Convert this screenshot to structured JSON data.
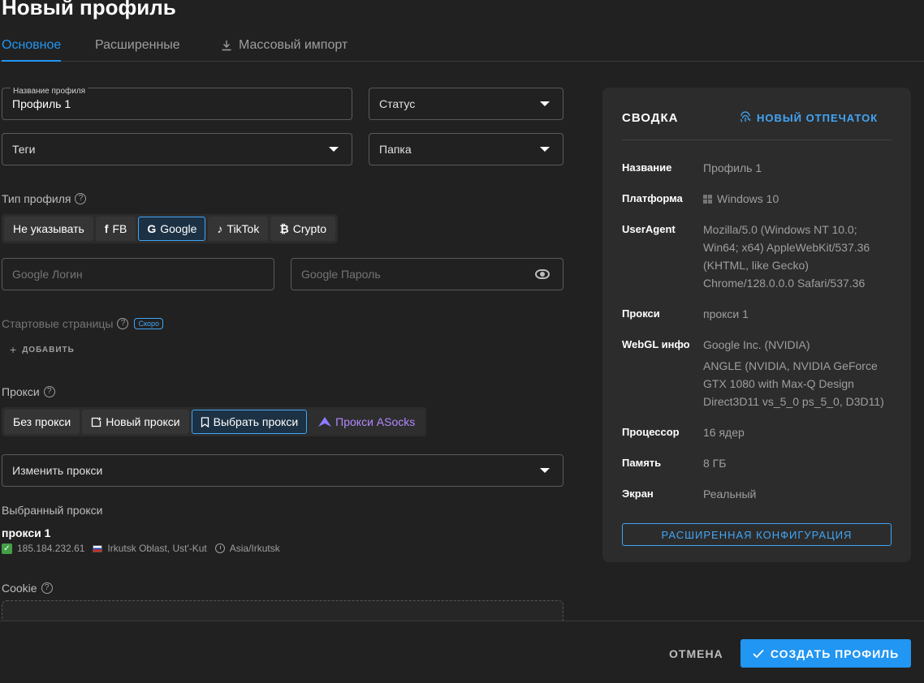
{
  "page": {
    "title": "Новый профиль"
  },
  "tabs": [
    {
      "label": "Основное",
      "active": true
    },
    {
      "label": "Расширенные",
      "active": false
    },
    {
      "label": "Массовый импорт",
      "active": false,
      "icon": "download-icon"
    }
  ],
  "form": {
    "profile_name": {
      "label": "Название профиля",
      "value": "Профиль 1"
    },
    "status": {
      "placeholder": "Статус"
    },
    "tags": {
      "placeholder": "Теги"
    },
    "folder": {
      "placeholder": "Папка"
    },
    "profile_type": {
      "label": "Тип профиля",
      "options": [
        {
          "label": "Не указывать",
          "icon": ""
        },
        {
          "label": "FB",
          "icon": "facebook-icon"
        },
        {
          "label": "Google",
          "icon": "google-icon",
          "selected": true
        },
        {
          "label": "TikTok",
          "icon": "tiktok-icon"
        },
        {
          "label": "Crypto",
          "icon": "bitcoin-icon"
        }
      ]
    },
    "google_login": {
      "placeholder": "Google Логин"
    },
    "google_password": {
      "placeholder": "Google Пароль"
    },
    "start_pages": {
      "label": "Стартовые страницы",
      "badge": "Скоро",
      "add_label": "ДОБАВИТЬ"
    },
    "proxy": {
      "label": "Прокси",
      "options": [
        {
          "label": "Без прокси",
          "icon": ""
        },
        {
          "label": "Новый прокси",
          "icon": "add-box-icon"
        },
        {
          "label": "Выбрать прокси",
          "icon": "bookmark-icon",
          "selected": true
        },
        {
          "label": "Прокси ASocks",
          "icon": "asocks-logo-icon"
        }
      ],
      "change_placeholder": "Изменить прокси",
      "selected_label": "Выбранный прокси",
      "selected": {
        "name": "прокси 1",
        "ip": "185.184.232.61",
        "location": "Irkutsk Oblast, Ust'-Kut",
        "timezone": "Asia/Irkutsk"
      }
    },
    "cookie": {
      "label": "Cookie"
    }
  },
  "summary": {
    "title": "СВОДКА",
    "fingerprint_button": "НОВЫЙ ОТПЕЧАТОК",
    "rows": [
      {
        "key": "Название",
        "value": [
          "Профиль 1"
        ]
      },
      {
        "key": "Платформа",
        "value": [
          "Windows 10"
        ]
      },
      {
        "key": "UserAgent",
        "value": [
          "Mozilla/5.0 (Windows NT 10.0;",
          "Win64; x64) AppleWebKit/537.36",
          "(KHTML, like Gecko)",
          "Chrome/128.0.0.0 Safari/537.36"
        ]
      },
      {
        "key": "Прокси",
        "value": [
          "прокси 1"
        ]
      },
      {
        "key": "WebGL инфо",
        "value": [
          "Google Inc. (NVIDIA)"
        ]
      },
      {
        "key": "",
        "value": [
          "ANGLE (NVIDIA, NVIDIA GeForce",
          "GTX 1080 with Max-Q Design",
          "Direct3D11 vs_5_0 ps_5_0, D3D11)"
        ]
      },
      {
        "key": "Процессор",
        "value": [
          "16 ядер"
        ]
      },
      {
        "key": "Память",
        "value": [
          "8 ГБ"
        ]
      },
      {
        "key": "Экран",
        "value": [
          "Реальный"
        ]
      }
    ],
    "advanced_button": "РАСШИРЕННАЯ КОНФИГУРАЦИЯ"
  },
  "footer": {
    "cancel": "ОТМЕНА",
    "create": "СОЗДАТЬ ПРОФИЛЬ"
  },
  "colors": {
    "accent": "#2196f3",
    "background": "#212121",
    "panel": "#2c2c2c",
    "asocks": "#b388ff",
    "success": "#43a047"
  }
}
